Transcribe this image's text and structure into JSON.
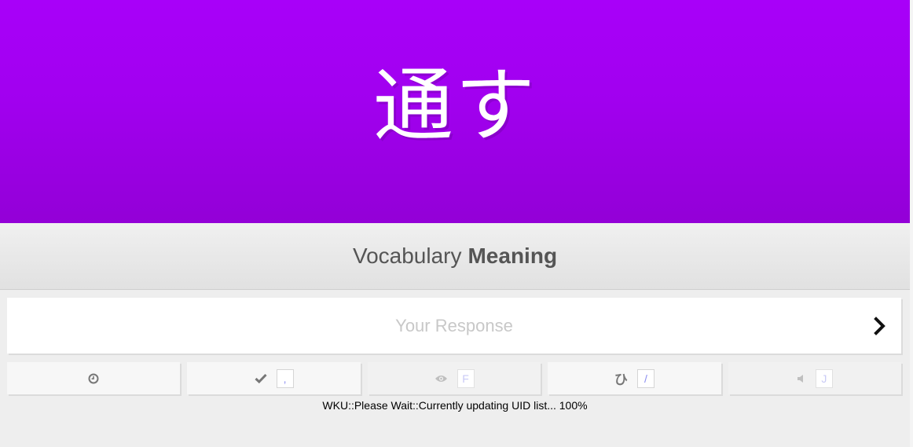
{
  "review": {
    "character": "通す",
    "question_type": {
      "kind": "Vocabulary",
      "mode": "Meaning"
    },
    "answer": {
      "placeholder": "Your Response",
      "value": ""
    }
  },
  "info_buttons": [
    {
      "icon": "clock-icon",
      "shortcut": "",
      "enabled": true
    },
    {
      "icon": "checkmark-icon",
      "shortcut": ",",
      "enabled": true
    },
    {
      "icon": "eye-icon",
      "shortcut": "F",
      "enabled": false
    },
    {
      "icon": "hiragana-icon",
      "label": "ひ",
      "shortcut": "/",
      "enabled": true
    },
    {
      "icon": "speaker-icon",
      "shortcut": "J",
      "enabled": false
    }
  ],
  "status": {
    "message": "WKU::Please Wait::Currently updating UID list... 100%"
  },
  "colors": {
    "vocabulary_purple": "#a100f1",
    "shortcut_key_text": "#8a8cf0"
  }
}
